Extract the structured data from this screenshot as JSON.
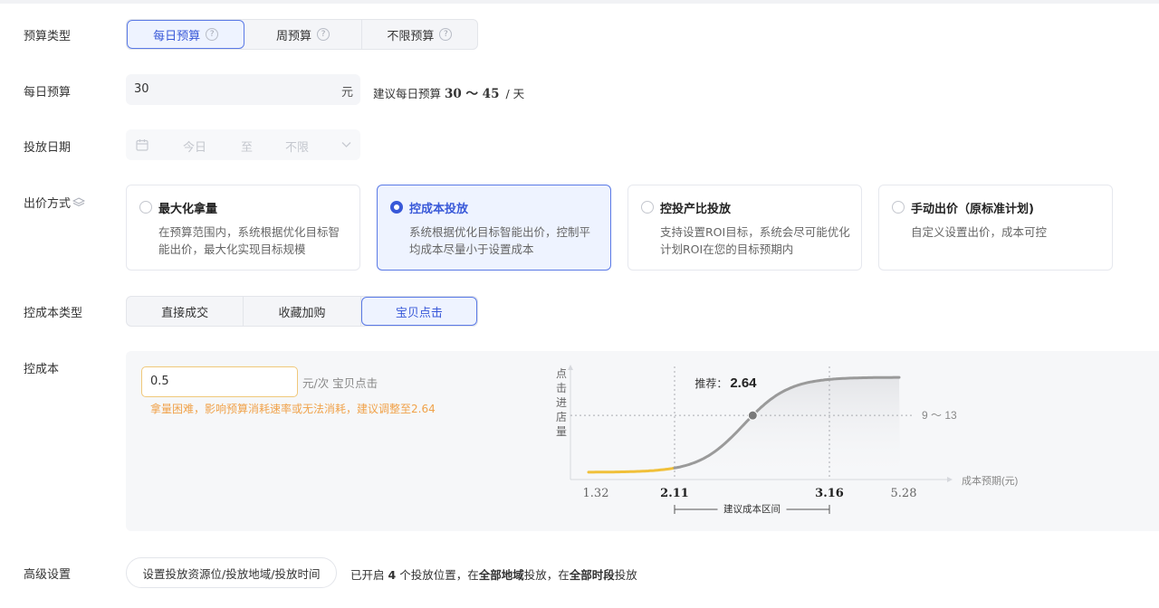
{
  "budget_type": {
    "label": "预算类型",
    "options": [
      {
        "label": "每日预算",
        "help": "?"
      },
      {
        "label": "周预算",
        "help": "?"
      },
      {
        "label": "不限预算",
        "help": "?"
      }
    ],
    "selected": "每日预算"
  },
  "daily_budget": {
    "label": "每日预算",
    "value": "30",
    "unit": "元",
    "suggest_prefix": "建议每日预算",
    "suggest_range": "30 ～ 45",
    "suggest_suffix": "/ 天"
  },
  "date": {
    "label": "投放日期",
    "start": "今日",
    "sep": "至",
    "end": "不限"
  },
  "bid": {
    "label": "出价方式",
    "cards": [
      {
        "title": "最大化拿量",
        "desc": "在预算范围内，系统根据优化目标智能出价，最大化实现目标规模",
        "selected": false
      },
      {
        "title": "控成本投放",
        "desc": "系统根据优化目标智能出价，控制平均成本尽量小于设置成本",
        "selected": true
      },
      {
        "title": "控投产比投放",
        "desc": "支持设置ROI目标，系统会尽可能优化计划ROI在您的目标预期内",
        "selected": false
      },
      {
        "title": "手动出价（原标准计划)",
        "desc": "自定义设置出价，成本可控",
        "selected": false
      }
    ]
  },
  "cost_type": {
    "label": "控成本类型",
    "options": [
      {
        "label": "直接成交"
      },
      {
        "label": "收藏加购"
      },
      {
        "label": "宝贝点击"
      }
    ],
    "selected": "宝贝点击"
  },
  "cost": {
    "label": "控成本",
    "value": "0.5",
    "unit": "元/次 宝贝点击",
    "warning": "拿量困难，影响预算消耗速率或无法消耗，建议调整至2.64"
  },
  "chart_data": {
    "type": "line",
    "ylabel": "点击进店量",
    "xlabel": "成本预期(元)",
    "x_ticks": [
      "1.32",
      "2.11",
      "3.16",
      "5.28"
    ],
    "x": [
      1.32,
      2.11,
      2.64,
      3.16,
      5.28
    ],
    "y_level_label": "9 ～ 13",
    "recommend_label": "推荐：",
    "recommend_value": "2.64",
    "range_label": "建议成本区间",
    "colors": {
      "low": "#f0c03a",
      "main": "#9a9a9a",
      "marker": "#7a7a7a"
    }
  },
  "advanced": {
    "label": "高级设置",
    "button": "设置投放资源位/投放地域/投放时间",
    "info_1": "已开启",
    "info_count": "4",
    "info_2": "个投放位置，在",
    "info_region": "全部地域",
    "info_3": "投放，在",
    "info_time": "全部时段",
    "info_4": "投放"
  }
}
